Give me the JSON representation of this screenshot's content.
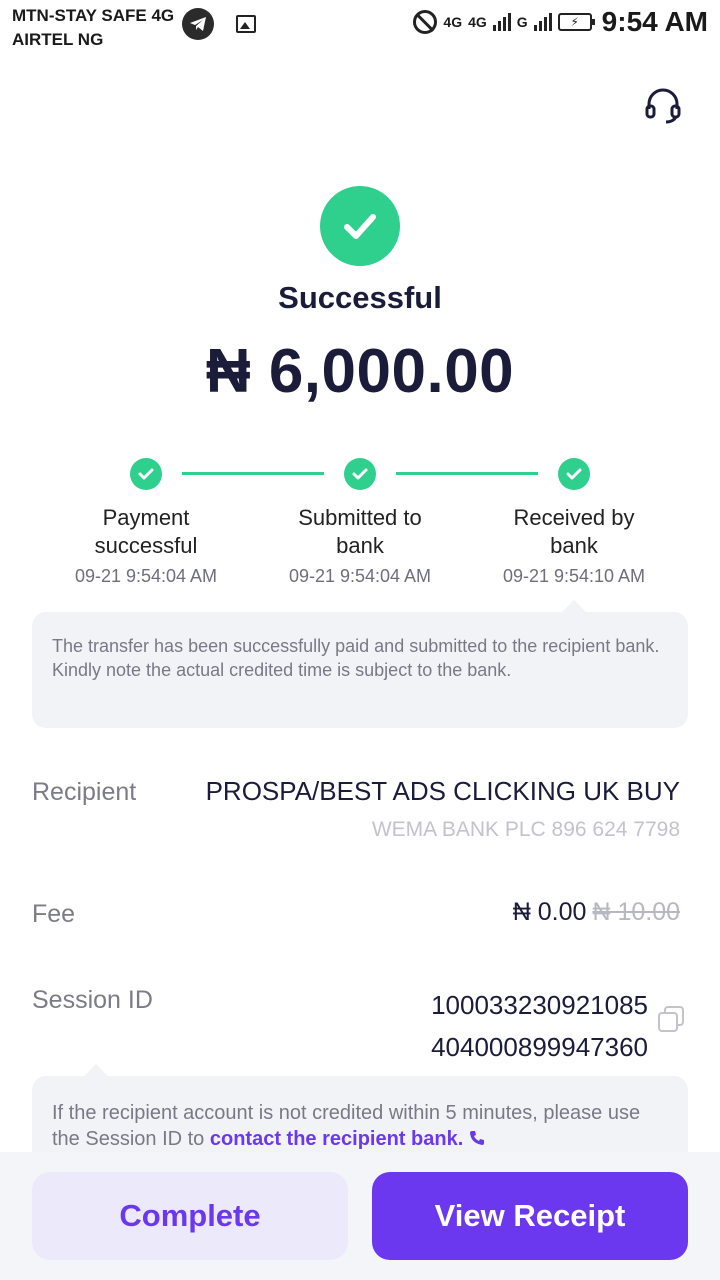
{
  "status_bar": {
    "carrier_1": "MTN-STAY SAFE 4G",
    "carrier_2": "AIRTEL NG",
    "network_1": "4G",
    "network_2": "4G",
    "network_3": "G",
    "time": "9:54 AM",
    "icons": [
      "telegram-icon",
      "gallery-icon",
      "do-not-disturb-icon",
      "signal-icon",
      "battery-charging-icon"
    ]
  },
  "header": {
    "support_icon": "headset-icon"
  },
  "result": {
    "title": "Successful",
    "amount": "₦ 6,000.00",
    "accent_color": "#2fcf8e"
  },
  "steps": [
    {
      "label_1": "Payment",
      "label_2": "successful",
      "time": "09-21 9:54:04 AM"
    },
    {
      "label_1": "Submitted to",
      "label_2": "bank",
      "time": "09-21 9:54:04 AM"
    },
    {
      "label_1": "Received by",
      "label_2": "bank",
      "time": "09-21 9:54:10 AM"
    }
  ],
  "info_text": "The transfer has been successfully paid and submitted to the recipient bank. Kindly note the actual credited time is subject to the bank.",
  "details": {
    "recipient_label": "Recipient",
    "recipient_name": "PROSPA/BEST ADS CLICKING UK BUY",
    "recipient_bank": "WEMA BANK PLC 896 624 7798",
    "fee_label": "Fee",
    "fee_value": "₦ 0.00",
    "fee_original": "₦ 10.00",
    "session_label": "Session ID",
    "session_id_line_1": "100033230921085",
    "session_id_line_2": "404000899947360"
  },
  "hint": {
    "text": "If the recipient account is not credited within 5 minutes, please use the Session ID to ",
    "link": "contact the recipient bank."
  },
  "buttons": {
    "complete": "Complete",
    "view_receipt": "View Receipt",
    "primary_color": "#6b38f0"
  }
}
